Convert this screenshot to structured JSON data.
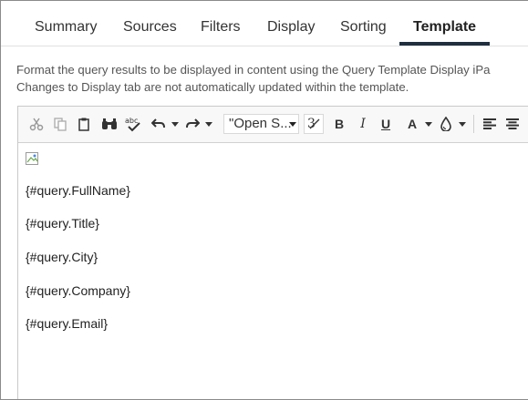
{
  "tabs": [
    {
      "label": "Summary",
      "active": false
    },
    {
      "label": "Sources",
      "active": false
    },
    {
      "label": "Filters",
      "active": false
    },
    {
      "label": "Display",
      "active": false
    },
    {
      "label": "Sorting",
      "active": false
    },
    {
      "label": "Template",
      "active": true
    }
  ],
  "description": {
    "line1": "Format the query results to be displayed in content using the Query Template Display iPa",
    "line2": "Changes to Display tab are not automatically updated within the template."
  },
  "toolbar": {
    "font_family_value": "\"Open S...",
    "buttons": [
      "cut-icon",
      "copy-icon",
      "paste-icon",
      "find-icon",
      "spellcheck-icon",
      "undo-icon",
      "redo-icon",
      "clear-format-icon",
      "bold-icon",
      "italic-icon",
      "underline-icon",
      "font-color-icon",
      "background-color-icon",
      "align-left-icon",
      "align-center-icon"
    ],
    "bold_label": "B",
    "italic_label": "I",
    "underline_label": "U",
    "font_color_label": "A"
  },
  "editor": {
    "lines": [
      "{#query.FullName}",
      "{#query.Title}",
      "{#query.City}",
      "{#query.Company}",
      "{#query.Email}"
    ]
  },
  "colors": {
    "tab_underline": "#1f2f3f",
    "toolbar_bg": "#f8f8f8",
    "border": "#c9c9c9"
  }
}
